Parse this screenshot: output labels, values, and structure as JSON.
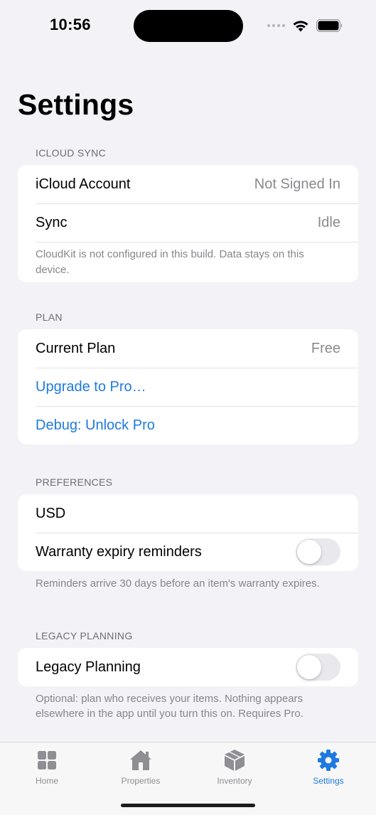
{
  "status_bar": {
    "time": "10:56"
  },
  "page": {
    "title": "Settings"
  },
  "icloud_sync": {
    "header": "ICLOUD SYNC",
    "account_label": "iCloud Account",
    "account_value": "Not Signed In",
    "sync_label": "Sync",
    "sync_value": "Idle",
    "note": "CloudKit is not configured in this build. Data stays on this device."
  },
  "plan": {
    "header": "PLAN",
    "current_label": "Current Plan",
    "current_value": "Free",
    "upgrade_label": "Upgrade to Pro…",
    "debug_label": "Debug: Unlock Pro"
  },
  "preferences": {
    "header": "PREFERENCES",
    "currency": "USD",
    "warranty_label": "Warranty expiry reminders",
    "warranty_enabled": false,
    "footer": "Reminders arrive 30 days before an item's warranty expires."
  },
  "legacy": {
    "header": "LEGACY PLANNING",
    "label": "Legacy Planning",
    "enabled": false,
    "footer": "Optional: plan who receives your items. Nothing appears elsewhere in the app until you turn this on. Requires Pro."
  },
  "tab_bar": {
    "tabs": [
      {
        "label": "Home",
        "icon": "grid-icon",
        "active": false
      },
      {
        "label": "Properties",
        "icon": "house-icon",
        "active": false
      },
      {
        "label": "Inventory",
        "icon": "box-icon",
        "active": false
      },
      {
        "label": "Settings",
        "icon": "gear-icon",
        "active": true
      }
    ]
  },
  "colors": {
    "accent": "#1f7ae0",
    "background": "#f2f2f7",
    "secondary_text": "#8a8a8e"
  }
}
